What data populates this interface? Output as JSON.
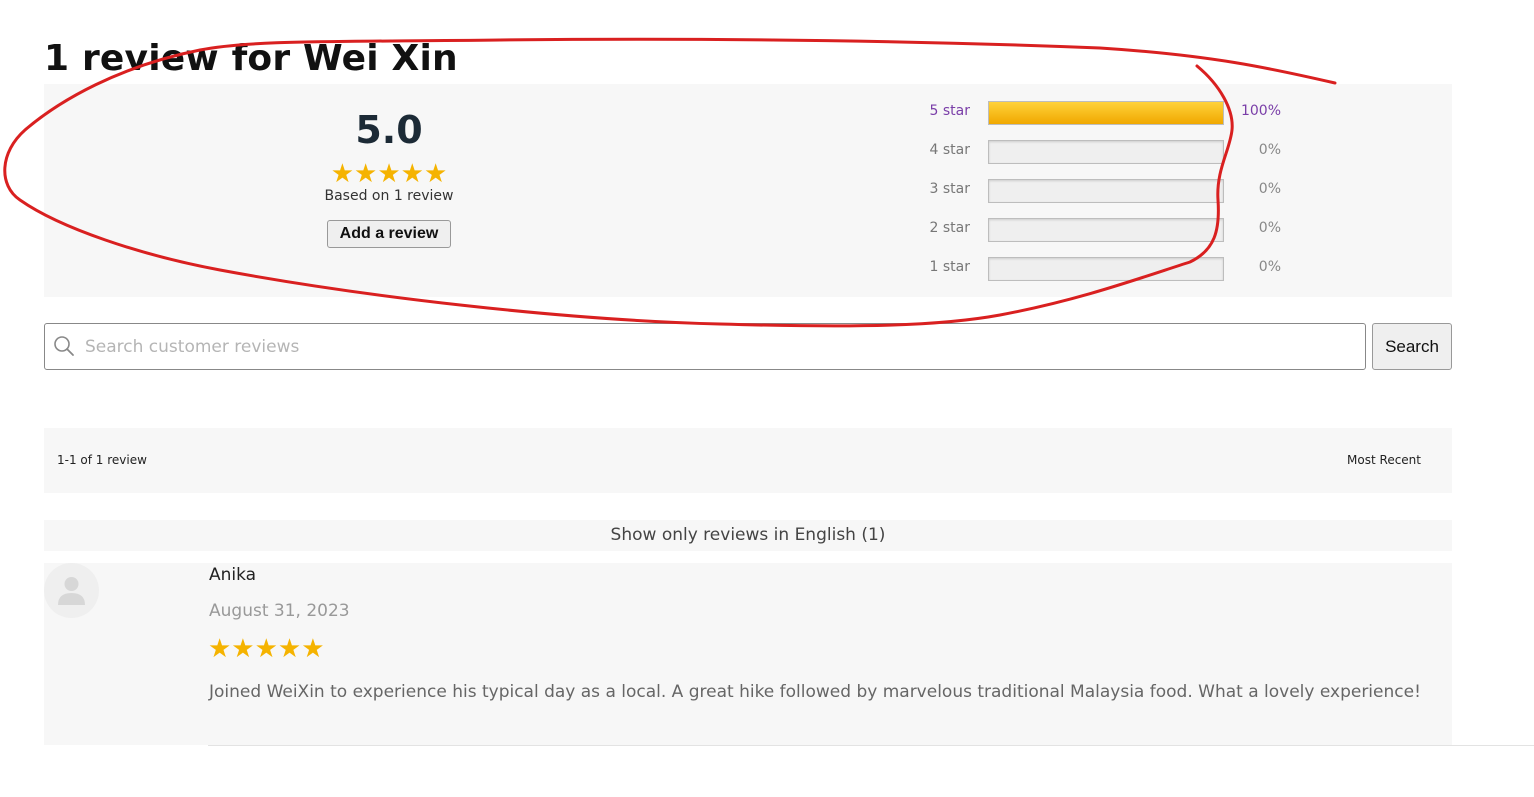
{
  "page": {
    "title": "1 review for Wei Xin"
  },
  "summary": {
    "average": "5.0",
    "average_stars": "★★★★★",
    "based_on": "Based on 1 review",
    "add_review_label": "Add a review",
    "distribution": [
      {
        "label": "5 star",
        "percent": "100%",
        "fraction": 1.0
      },
      {
        "label": "4 star",
        "percent": "0%",
        "fraction": 0
      },
      {
        "label": "3 star",
        "percent": "0%",
        "fraction": 0
      },
      {
        "label": "2 star",
        "percent": "0%",
        "fraction": 0
      },
      {
        "label": "1 star",
        "percent": "0%",
        "fraction": 0
      }
    ]
  },
  "search": {
    "placeholder": "Search customer reviews",
    "button_label": "Search",
    "icon": "search-icon"
  },
  "toolbar": {
    "count": "1-1 of 1 review",
    "sort_label": "Most Recent"
  },
  "filter": {
    "language_label": "Show only reviews in English (1)"
  },
  "reviews": [
    {
      "author": "Anika",
      "date": "August 31, 2023",
      "rating": 5,
      "stars": "★★★★★",
      "text": "Joined WeiXin to experience his typical day as a local. A great hike followed by marvelous traditional Malaysia food. What a lovely experience!"
    }
  ],
  "colors": {
    "star": "#f5b300",
    "bar_fill": "#f0a800",
    "active_label": "#7a3ea8",
    "panel_bg": "#f7f7f7",
    "annotation": "#d92020"
  }
}
